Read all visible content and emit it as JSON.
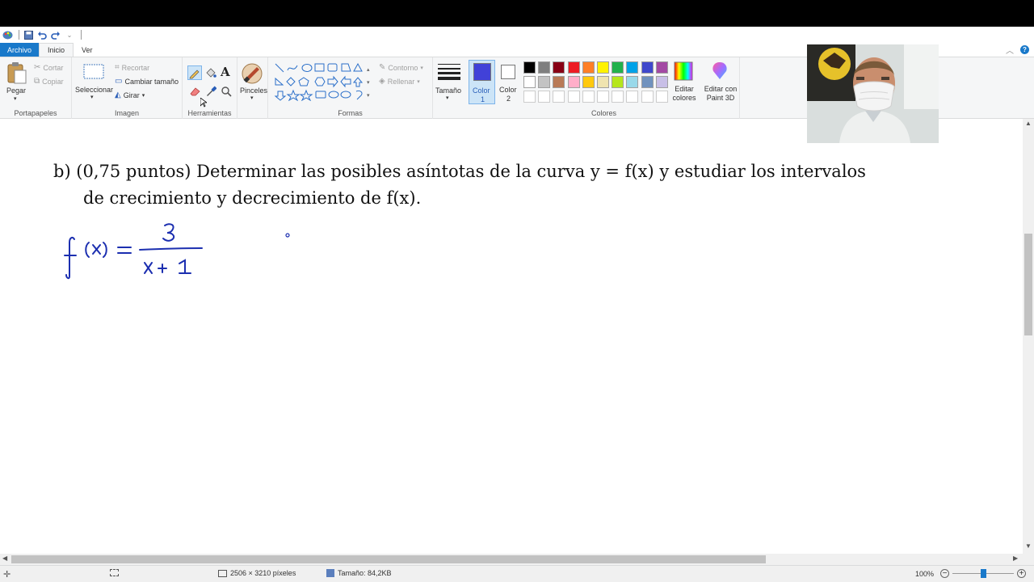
{
  "titlebar": {
    "icons": [
      "paint-app-icon",
      "save-icon",
      "undo-icon",
      "redo-icon",
      "customize-quick-access-icon"
    ]
  },
  "tabs": {
    "file": "Archivo",
    "home": "Inicio",
    "view": "Ver"
  },
  "ribbon": {
    "clipboard": {
      "paste": "Pegar",
      "cut": "Cortar",
      "copy": "Copiar",
      "label": "Portapapeles"
    },
    "image": {
      "select": "Seleccionar",
      "crop": "Recortar",
      "resize": "Cambiar tamaño",
      "rotate": "Girar",
      "label": "Imagen"
    },
    "tools": {
      "label": "Herramientas",
      "items": [
        "pencil-icon",
        "fill-icon",
        "text-icon",
        "eraser-icon",
        "color-picker-icon",
        "magnifier-icon"
      ]
    },
    "brushes": {
      "label": "Pinceles"
    },
    "shapes": {
      "label": "Formas",
      "outline": "Contorno",
      "fill": "Rellenar"
    },
    "size": {
      "label": "Tamaño"
    },
    "color1": {
      "label": "Color",
      "number": "1",
      "value": "#4141d8"
    },
    "color2": {
      "label": "Color",
      "number": "2",
      "value": "#ffffff"
    },
    "colors": {
      "label": "Colores",
      "edit": "Editar colores",
      "row1": [
        "#000000",
        "#7f7f7f",
        "#880015",
        "#ed1c24",
        "#ff7f27",
        "#fff200",
        "#22b14c",
        "#00a2e8",
        "#3f48cc",
        "#a349a4"
      ],
      "row2": [
        "#ffffff",
        "#c3c3c3",
        "#b97a57",
        "#ffaec9",
        "#ffc90e",
        "#efe4b0",
        "#b5e61d",
        "#99d9ea",
        "#7092be",
        "#c8bfe7"
      ]
    },
    "paint3d": {
      "label": "Editar con Paint 3D"
    }
  },
  "canvas": {
    "problem_line1": "b)  (0,75 puntos) Determinar las posibles asíntotas de la curva y = f(x) y estudiar los intervalos",
    "problem_line2": "de crecimiento y decrecimiento de f(x).",
    "handwriting": {
      "lhs": "f(x) =",
      "numerator": "3",
      "denominator": "x + 1",
      "ink_color": "#1c2fb0"
    }
  },
  "statusbar": {
    "dimensions": "2506 × 3210 píxeles",
    "file_size": "Tamaño: 84,2KB",
    "zoom": "100%",
    "zoom_slider_level_percent": 50
  }
}
